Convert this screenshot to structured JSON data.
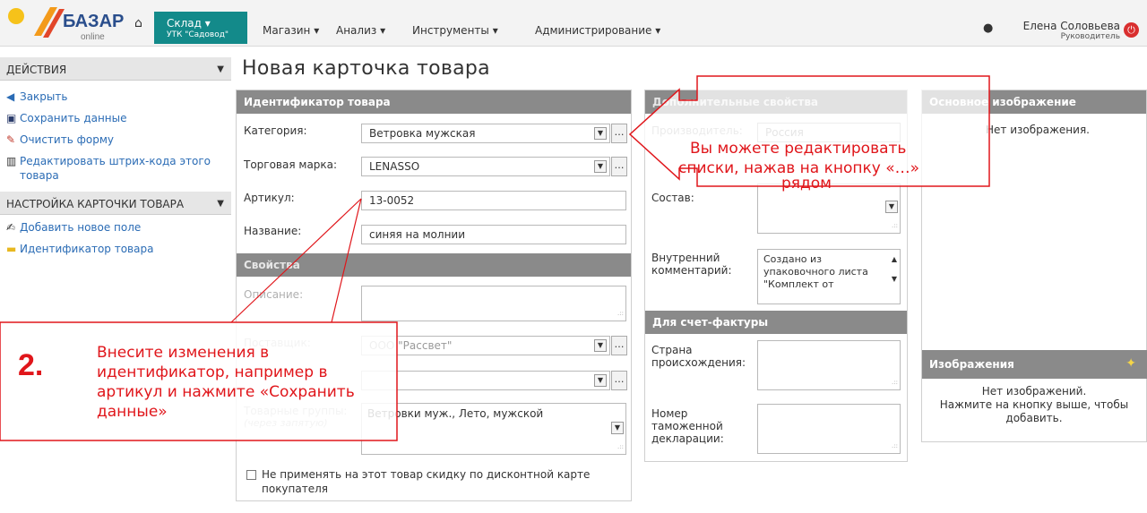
{
  "brand": {
    "logo_text": "БАЗАР",
    "logo_sub": "online"
  },
  "nav": {
    "active_title": "Склад ▾",
    "active_sub": "УТК \"Садовод\"",
    "items": [
      "Магазин ▾",
      "Анализ ▾",
      "Инструменты ▾",
      "Администрирование ▾"
    ]
  },
  "user": {
    "name": "Елена Соловьева",
    "role": "Руководитель"
  },
  "sidebar": {
    "actions_title": "ДЕЙСТВИЯ",
    "actions": [
      "Закрыть",
      "Сохранить данные",
      "Очистить форму",
      "Редактировать штрих-кода этого",
      "товара"
    ],
    "setup_title": "НАСТРОЙКА КАРТОЧКИ ТОВАРА",
    "setup": [
      "Добавить новое поле",
      "Идентификатор товара"
    ]
  },
  "page_title": "Новая карточка товара",
  "identifier": {
    "title": "Идентификатор товара",
    "category_label": "Категория:",
    "category_value": "Ветровка мужская",
    "brand_label": "Торговая марка:",
    "brand_value": "LENASSO",
    "article_label": "Артикул:",
    "article_value": "13-0052",
    "name_label": "Название:",
    "name_value": "синяя на молнии"
  },
  "properties": {
    "title": "Свойства",
    "description_label": "Описание:",
    "supplier_label": "Поставщик:",
    "supplier_value": "ООО \"Рассвет\"",
    "groups_label": "Товарные группы:",
    "groups_hint": "(через запятую)",
    "groups_value": "Ветровки муж., Лето, мужской",
    "discount_label_1": "Не применять на этот товар скидку по дисконтной карте",
    "discount_label_2": "покупателя"
  },
  "extra": {
    "title": "Дополнительные свойства",
    "maker_label": "Производитель:",
    "maker_value": "Россия",
    "composition_label": "Состав:",
    "comment_label_1": "Внутренний",
    "comment_label_2": "комментарий:",
    "comment_value_1": "Создано из",
    "comment_value_2": "упаковочного листа",
    "comment_value_3": "\"Комплект от"
  },
  "invoice": {
    "title": "Для счет-фактуры",
    "country_label_1": "Страна",
    "country_label_2": "происхождения:",
    "customs_label_1": "Номер",
    "customs_label_2": "таможенной",
    "customs_label_3": "декларации:"
  },
  "main_image": {
    "title": "Основное изображение",
    "empty": "Нет изображения."
  },
  "images": {
    "title": "Изображения",
    "empty_1": "Нет изображений.",
    "empty_2": "Нажмите на кнопку выше, чтобы",
    "empty_3": "добавить."
  },
  "annotations": {
    "top_1": "Вы можете редактировать",
    "top_2": "списки, нажав на кнопку «…»",
    "top_3": "рядом",
    "step_number": "2.",
    "bottom_1": "Внесите изменения в",
    "bottom_2": "идентификатор, например в",
    "bottom_3": "артикул и нажмите «Сохранить",
    "bottom_4": "данные»",
    "color": "#e0161b"
  }
}
